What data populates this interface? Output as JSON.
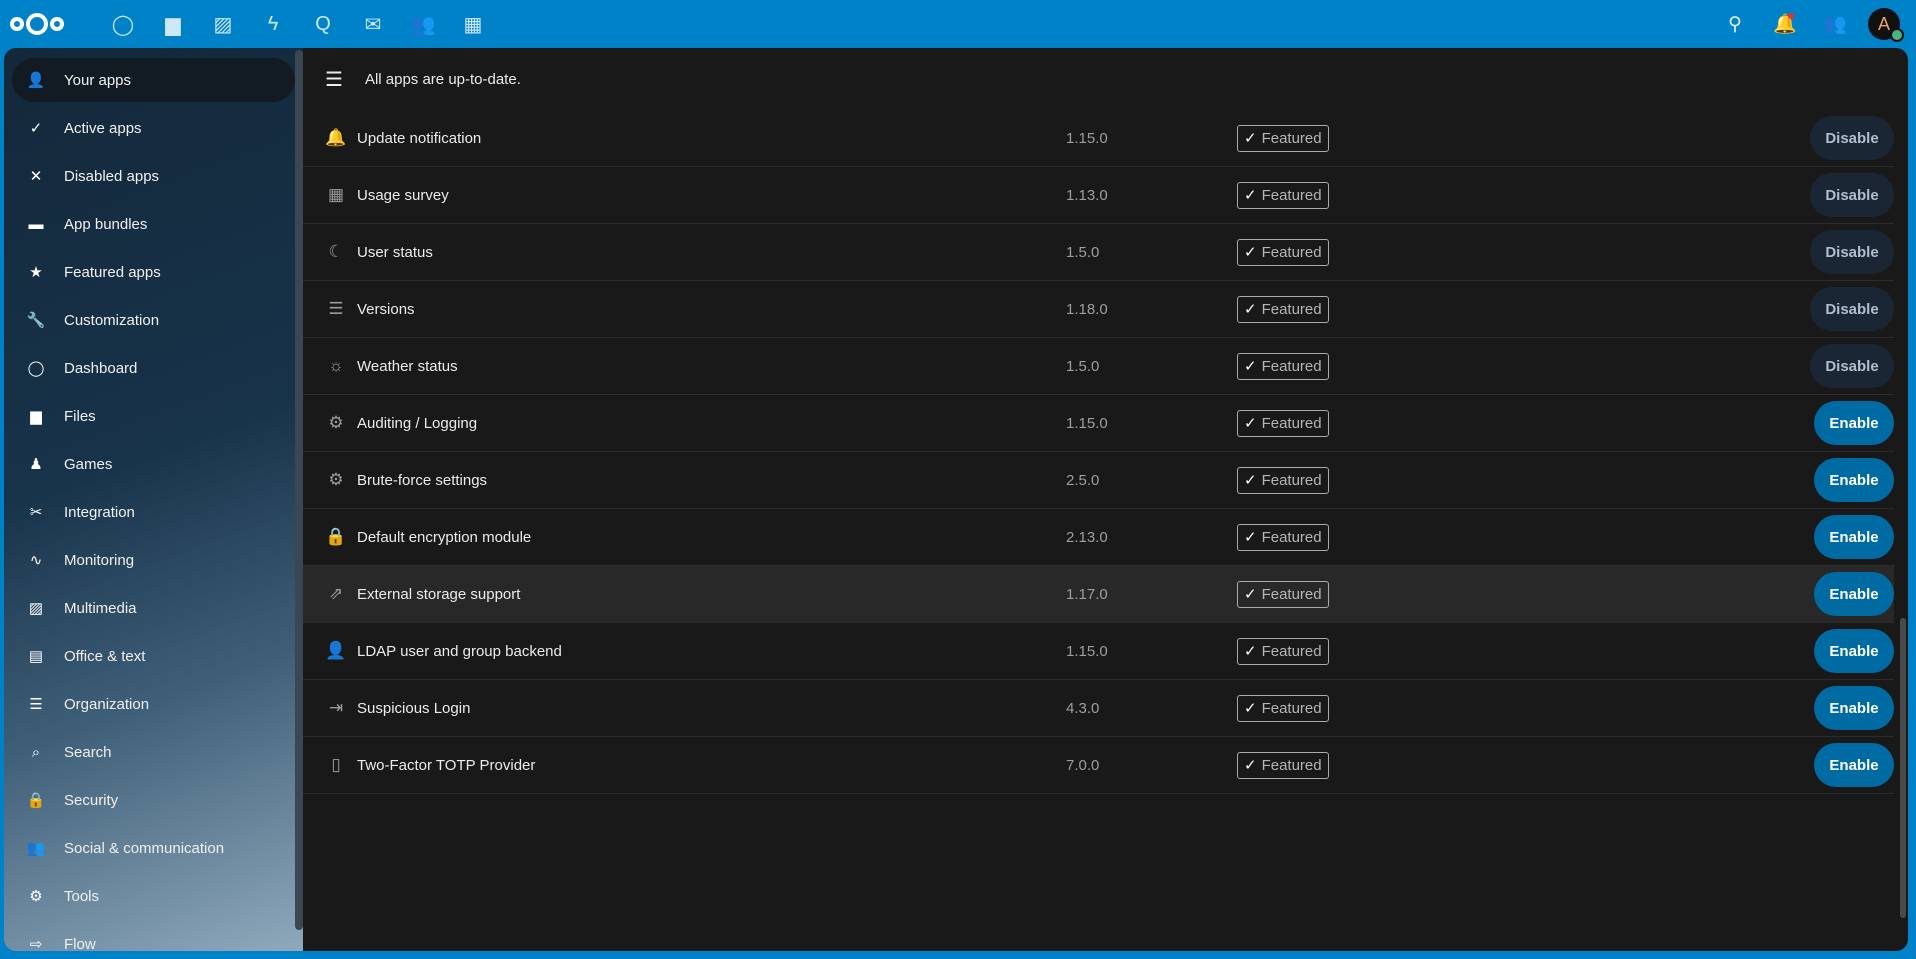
{
  "header": {
    "apps": [
      {
        "name": "dashboard-icon",
        "glyph": "◯"
      },
      {
        "name": "files-icon",
        "glyph": "▆"
      },
      {
        "name": "photos-icon",
        "glyph": "▨"
      },
      {
        "name": "activity-icon",
        "glyph": "ϟ"
      },
      {
        "name": "talk-icon",
        "glyph": "Q"
      },
      {
        "name": "mail-icon",
        "glyph": "✉"
      },
      {
        "name": "contacts-icon",
        "glyph": "👥"
      },
      {
        "name": "calendar-icon",
        "glyph": "▦"
      }
    ],
    "avatar_letter": "A"
  },
  "sidebar": {
    "items": [
      {
        "label": "Your apps",
        "icon": "user-icon",
        "glyph": "👤"
      },
      {
        "label": "Active apps",
        "icon": "check-icon",
        "glyph": "✓"
      },
      {
        "label": "Disabled apps",
        "icon": "close-icon",
        "glyph": "✕"
      },
      {
        "label": "App bundles",
        "icon": "archive-icon",
        "glyph": "▬"
      },
      {
        "label": "Featured apps",
        "icon": "star-icon",
        "glyph": "★"
      },
      {
        "label": "Customization",
        "icon": "wrench-icon",
        "glyph": "🔧"
      },
      {
        "label": "Dashboard",
        "icon": "circle-icon",
        "glyph": "◯"
      },
      {
        "label": "Files",
        "icon": "folder-icon",
        "glyph": "▆"
      },
      {
        "label": "Games",
        "icon": "gamepad-icon",
        "glyph": "♟"
      },
      {
        "label": "Integration",
        "icon": "tool-icon",
        "glyph": "✂"
      },
      {
        "label": "Monitoring",
        "icon": "pulse-icon",
        "glyph": "∿"
      },
      {
        "label": "Multimedia",
        "icon": "image-icon",
        "glyph": "▨"
      },
      {
        "label": "Office & text",
        "icon": "document-icon",
        "glyph": "▤"
      },
      {
        "label": "Organization",
        "icon": "list-icon",
        "glyph": "☰"
      },
      {
        "label": "Search",
        "icon": "search-icon",
        "glyph": "⌕"
      },
      {
        "label": "Security",
        "icon": "lock-icon",
        "glyph": "🔒"
      },
      {
        "label": "Social & communication",
        "icon": "people-icon",
        "glyph": "👥"
      },
      {
        "label": "Tools",
        "icon": "gear-icon",
        "glyph": "⚙"
      },
      {
        "label": "Flow",
        "icon": "flow-icon",
        "glyph": "⇨"
      }
    ]
  },
  "main": {
    "status": "All apps are up-to-date.",
    "featured_label": "Featured",
    "apps": [
      {
        "name": "Update notification",
        "version": "1.15.0",
        "action": "Disable",
        "icon": "bell-icon",
        "glyph": "🔔"
      },
      {
        "name": "Usage survey",
        "version": "1.13.0",
        "action": "Disable",
        "icon": "clipboard-icon",
        "glyph": "▦"
      },
      {
        "name": "User status",
        "version": "1.5.0",
        "action": "Disable",
        "icon": "moon-icon",
        "glyph": "☾"
      },
      {
        "name": "Versions",
        "version": "1.18.0",
        "action": "Disable",
        "icon": "list-icon",
        "glyph": "☰"
      },
      {
        "name": "Weather status",
        "version": "1.5.0",
        "action": "Disable",
        "icon": "sun-icon",
        "glyph": "☼"
      },
      {
        "name": "Auditing / Logging",
        "version": "1.15.0",
        "action": "Enable",
        "icon": "gear-icon",
        "glyph": "⚙"
      },
      {
        "name": "Brute-force settings",
        "version": "2.5.0",
        "action": "Enable",
        "icon": "gear-icon",
        "glyph": "⚙"
      },
      {
        "name": "Default encryption module",
        "version": "2.13.0",
        "action": "Enable",
        "icon": "lock-icon",
        "glyph": "🔒"
      },
      {
        "name": "External storage support",
        "version": "1.17.0",
        "action": "Enable",
        "icon": "external-link-icon",
        "glyph": "⇗"
      },
      {
        "name": "LDAP user and group backend",
        "version": "1.15.0",
        "action": "Enable",
        "icon": "user-icon",
        "glyph": "👤"
      },
      {
        "name": "Suspicious Login",
        "version": "4.3.0",
        "action": "Enable",
        "icon": "login-icon",
        "glyph": "⇥"
      },
      {
        "name": "Two-Factor TOTP Provider",
        "version": "7.0.0",
        "action": "Enable",
        "icon": "phone-icon",
        "glyph": "▯"
      }
    ]
  }
}
